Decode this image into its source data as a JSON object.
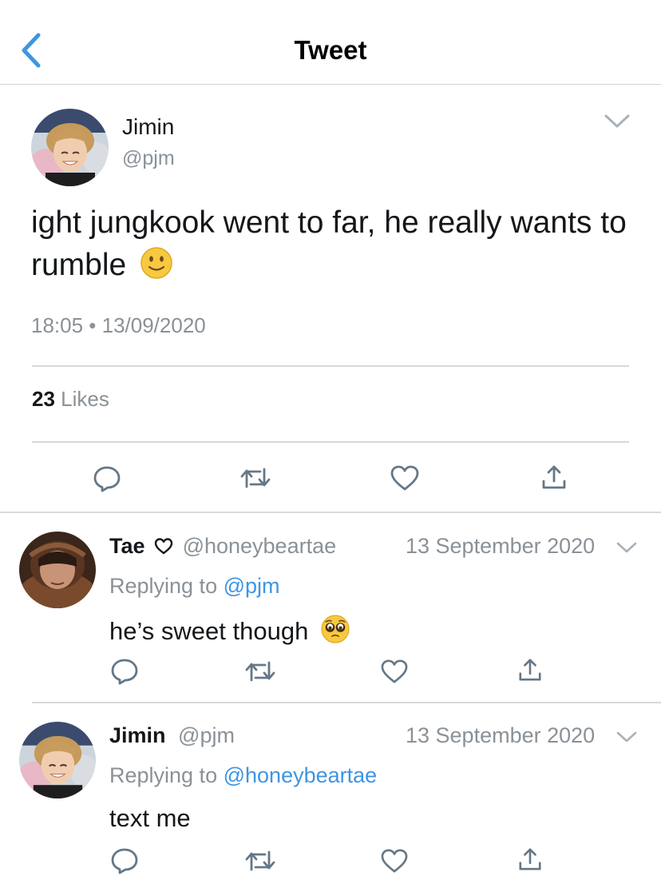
{
  "header": {
    "title": "Tweet"
  },
  "tweet": {
    "name": "Jimin",
    "handle": "@pjm",
    "text": "ight jungkook went to far, he really wants to rumble",
    "timestamp": "18:05 • 13/09/2020",
    "likes_count": "23",
    "likes_label": "Likes"
  },
  "replies": [
    {
      "name": "Tae",
      "handle": "@honeybeartae",
      "date": "13 September 2020",
      "replying_label": "Replying to",
      "replying_to": "@pjm",
      "text": "he’s sweet though"
    },
    {
      "name": "Jimin",
      "handle": "@pjm",
      "date": "13 September 2020",
      "replying_label": "Replying to",
      "replying_to": "@honeybeartae",
      "text": "text me"
    }
  ],
  "colors": {
    "link": "#3e95e3",
    "icon": "#657786",
    "muted": "#8a9197",
    "divider": "#d6d9dc"
  },
  "icons": [
    "back-chevron-icon",
    "chevron-down-icon",
    "reply-icon",
    "retweet-icon",
    "like-icon",
    "share-icon",
    "slightly-smiling-face-emoji",
    "pleading-face-emoji",
    "heart-outline-icon"
  ]
}
